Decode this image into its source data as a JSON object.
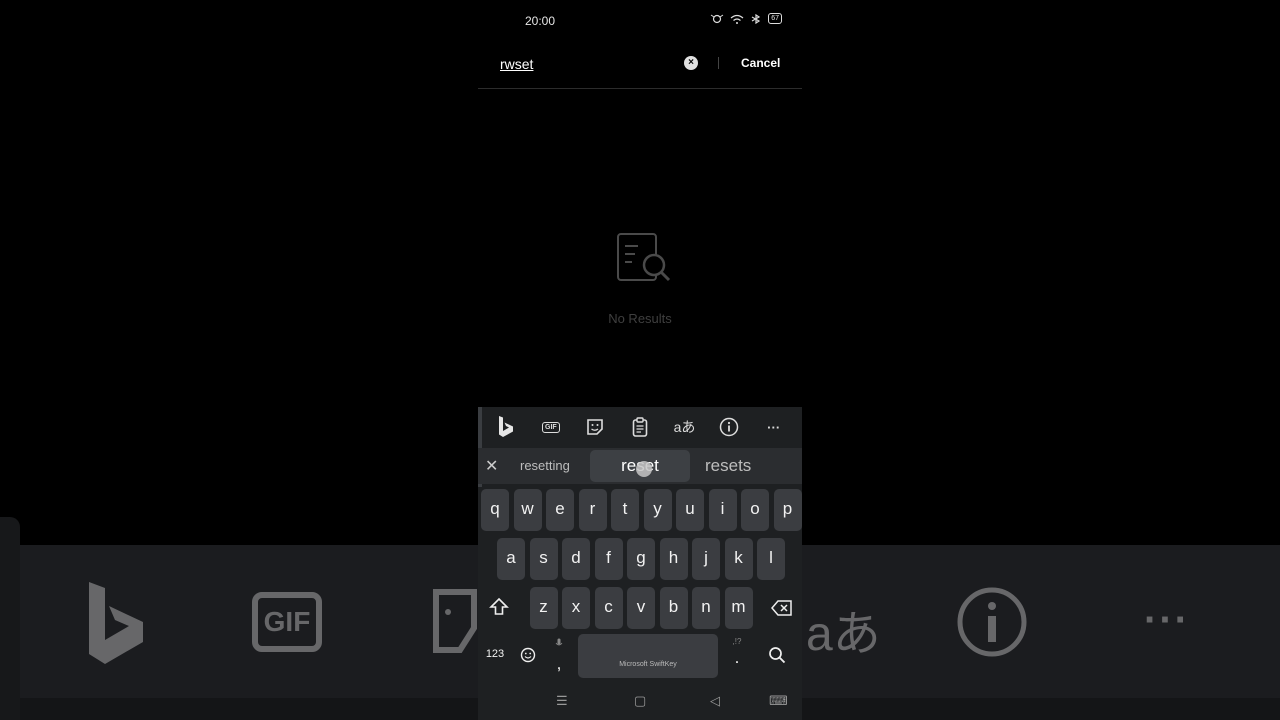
{
  "status_bar": {
    "time": "20:00",
    "battery": "67"
  },
  "search": {
    "query": "rwset",
    "cancel_label": "Cancel",
    "clear_glyph": "×"
  },
  "empty_state": {
    "icon": "document-search-icon",
    "message": "No Results"
  },
  "keyboard": {
    "toolbar": [
      "bing-icon",
      "gif-icon",
      "sticker-icon",
      "clipboard-icon",
      "translate-icon",
      "info-icon",
      "more-icon"
    ],
    "gif_label": "GIF",
    "translate_label": "aあ",
    "more_label": "···",
    "close_glyph": "✕",
    "suggestions": [
      "resetting",
      "reset",
      "resets"
    ],
    "rows": [
      [
        "q",
        "w",
        "e",
        "r",
        "t",
        "y",
        "u",
        "i",
        "o",
        "p"
      ],
      [
        "a",
        "s",
        "d",
        "f",
        "g",
        "h",
        "j",
        "k",
        "l"
      ],
      [
        "z",
        "x",
        "c",
        "v",
        "b",
        "n",
        "m"
      ]
    ],
    "numbers_label": "123",
    "comma_label": ",",
    "period_label": ".",
    "punct_hint": ",!?",
    "space_label": "Microsoft SwiftKey",
    "nav": {
      "menu": "☰",
      "home": "▢",
      "back": "◁",
      "keyboard": "⌨"
    }
  },
  "background": {
    "gif_label": "GIF",
    "translate_label": "aあ",
    "more_label": "···"
  }
}
